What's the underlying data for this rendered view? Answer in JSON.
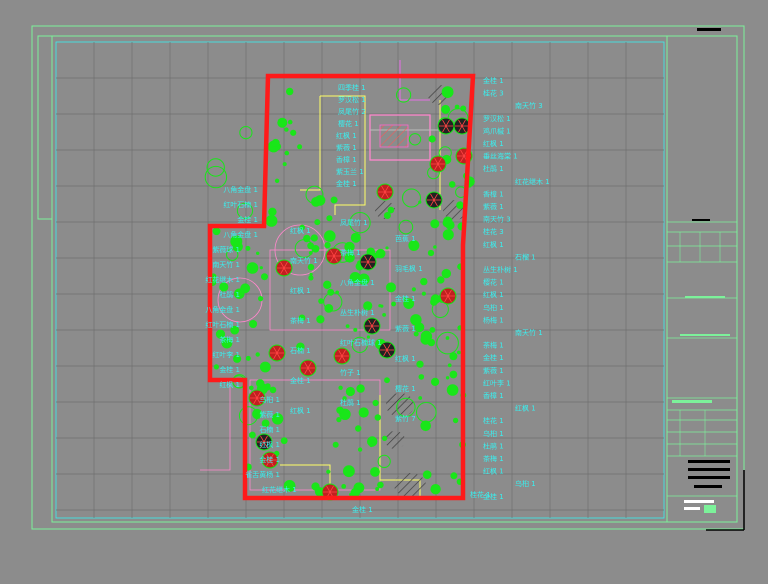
{
  "drawing": {
    "colors": {
      "background": "#8c8c8c",
      "frame": "#7cf29a",
      "grid": "#6f6f6f",
      "boundary": "#ff1a1a",
      "label": "#39f0f0",
      "plant": "#19e619",
      "path": "#ffff66",
      "structure": "#ff88cc",
      "tree": "#b03030",
      "hatch": "#404040",
      "titleblock_bar": "#000000"
    },
    "labels_left": [
      "八角金盘 1",
      "红叶石楠 1",
      "金桂 1",
      "八角金盘 1",
      "紫薇球 1",
      "南天竹 1",
      "红花继木 1",
      "杜鹃 1",
      "八角金盘 1",
      "红叶石楠 1",
      "茶梅 1",
      "红叶李 1",
      "金桂 1",
      "红枫 1",
      "乌桕 1",
      "紫薇 1",
      "石楠 1",
      "红枫 1",
      "金桂 1",
      "雀舌黄杨 1"
    ],
    "labels_top": [
      "四季桂 1",
      "罗汉松 1",
      "凤尾竹 2",
      "樱花 1",
      "红枫 1",
      "紫薇 1",
      "香樟 1",
      "紫玉兰 1",
      "金桂 1"
    ],
    "labels_right": [
      "金桂 1",
      "桂花 3",
      "南天竹 3",
      "罗汉松 1",
      "鸡爪槭 1",
      "红枫 1",
      "垂丝海棠 1",
      "杜鹃 1",
      "红花继木 1",
      "香樟 1",
      "紫薇 1",
      "南天竹 3",
      "桂花 3",
      "红枫 1",
      "石榴 1",
      "丛生朴树 1",
      "樱花 1",
      "红枫 1",
      "乌桕 1",
      "杨梅 1",
      "南天竹 1",
      "茶梅 1",
      "金桂 1",
      "紫薇 1",
      "红叶李 1",
      "香樟 1",
      "红枫 1",
      "桂花 1",
      "乌桕 1",
      "杜鹃 1",
      "茶梅 1",
      "红枫 1",
      "乌桕 1",
      "金桂 1"
    ],
    "labels_inner": [
      "凤尾竹 1",
      "红枫 1",
      "芭蕉 1",
      "茶梅 1",
      "南天竹 1",
      "羽毛枫 1",
      "八角金盘 1",
      "红枫 1",
      "金桂 1",
      "丛生朴树 1",
      "茶梅 1",
      "紫薇 1",
      "红叶石楠球 1",
      "石楠 1",
      "红枫 1",
      "竹子 1",
      "金桂 1",
      "樱花 1",
      "杜鹃 1",
      "红枫 1",
      "紫竹 7"
    ],
    "labels_bottom": [
      "红花继木 1",
      "金桂 1",
      "桂花 1"
    ]
  }
}
